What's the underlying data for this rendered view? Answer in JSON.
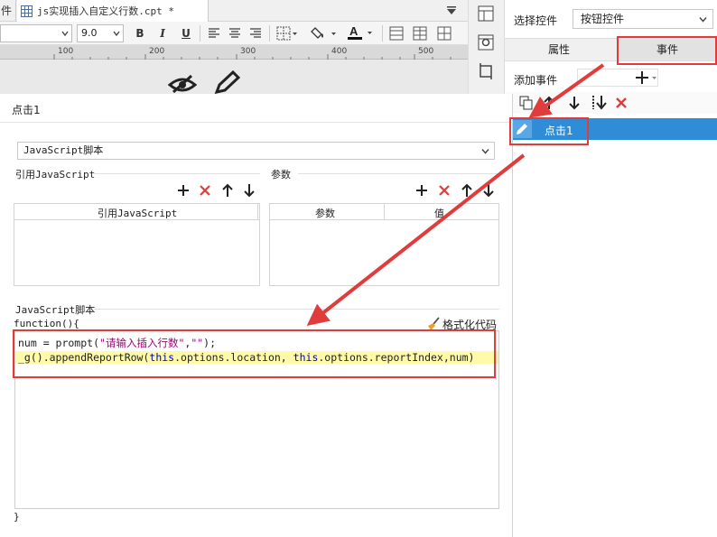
{
  "editor": {
    "tab_fragment": "件",
    "doc_tab": {
      "label": "js实现插入自定义行数.cpt *"
    },
    "toolbar": {
      "font_size": "9.0",
      "bold": "B",
      "italic": "I",
      "underline": "U"
    },
    "ruler_labels": [
      "100",
      "200",
      "300",
      "400",
      "500"
    ]
  },
  "right_panel": {
    "select_control_label": "选择控件",
    "select_control_value": "按钮控件",
    "tabs": [
      {
        "label": "属性",
        "active": false
      },
      {
        "label": "事件",
        "active": true
      }
    ],
    "add_event_label": "添加事件",
    "event_item_label": "点击1"
  },
  "dialog": {
    "title": "点击1",
    "js_type": "JavaScript脚本",
    "ref_section_label": "引用JavaScript",
    "ref_table_header": "引用JavaScript",
    "param_section_label": "参数",
    "param_table_headers": [
      "参数",
      "值"
    ],
    "script_section_label": "JavaScript脚本",
    "format_code_label": "格式化代码",
    "code_open": "function(){",
    "code_close": "}",
    "code_line1": {
      "prefix": "num = prompt(",
      "string1": "\"请输入插入行数\"",
      "comma": ",",
      "string2": "\"\"",
      "suffix": ");"
    },
    "code_line2": {
      "p1": "_g().appendReportRow(",
      "kw1": "this",
      "p2": ".options.location, ",
      "kw2": "this",
      "p3": ".options.reportIndex,num)"
    }
  },
  "colors": {
    "accent_blue": "#2f8dd8",
    "annotation_red": "#e03c3c",
    "keyword_blue": "#0000c0",
    "string_magenta": "#a5007a",
    "highlight_yellow": "#fffaa8"
  }
}
